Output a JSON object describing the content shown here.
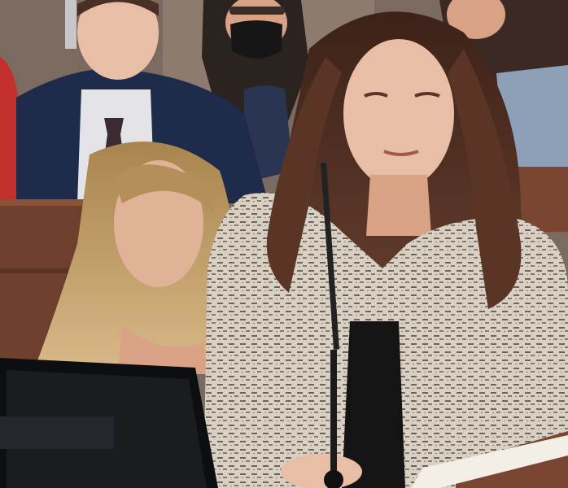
{
  "scene": {
    "colors": {
      "wall": "#7a6a60",
      "bench_wood": "#6e3f2c",
      "bench_wood_light": "#8a5238",
      "red_shirt": "#c4312d",
      "navy_suit": "#1f2b4a",
      "white_shirt": "#e4e4e8",
      "tie": "#3b2a33",
      "skin_light": "#e8bfa6",
      "skin_warm": "#d9a285",
      "blonde_hair": "#c9a46e",
      "blonde_hair_dark": "#9c7a4a",
      "brown_hair": "#5a3526",
      "brown_hair_dark": "#3d2219",
      "tweed": "#d9d0c4",
      "tweed_fleck": "#4a4038",
      "black_top": "#141414",
      "monitor": "#1a1c20",
      "monitor_frame": "#0d0e10",
      "mic": "#222222",
      "lectern": "#7a4631",
      "paper": "#f3efe6",
      "mask": "#161616"
    }
  }
}
